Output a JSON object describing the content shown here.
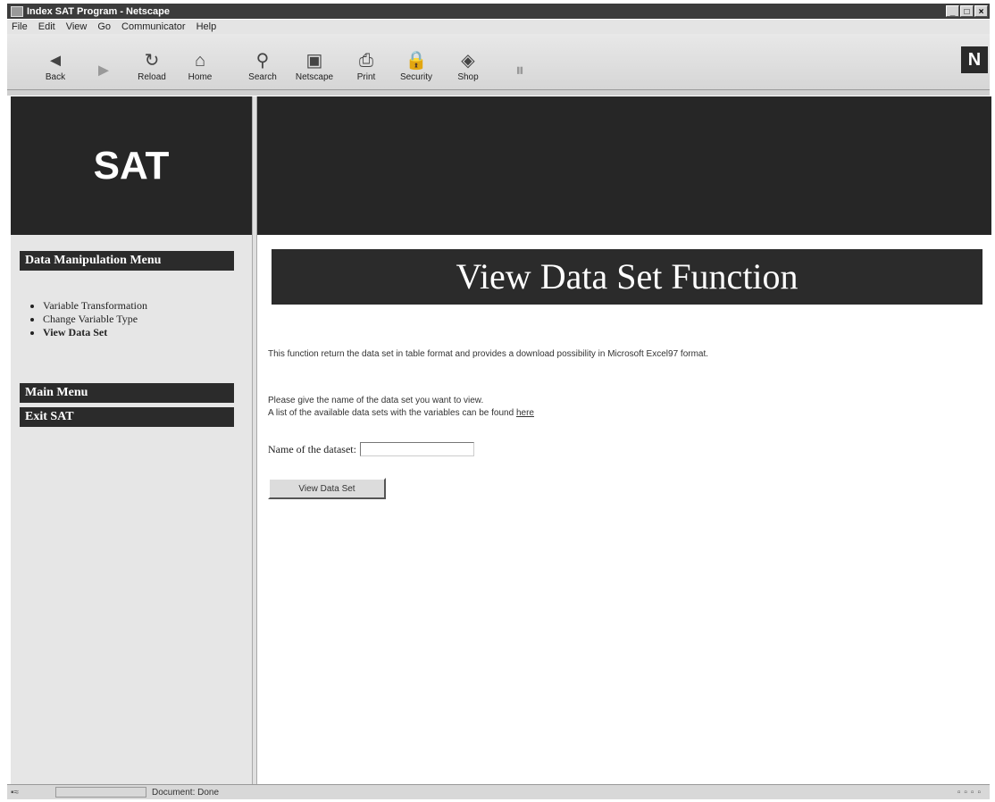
{
  "window": {
    "title": "Index SAT Program - Netscape",
    "controls": [
      "_",
      "□",
      "×"
    ]
  },
  "menubar": [
    "File",
    "Edit",
    "View",
    "Go",
    "Communicator",
    "Help"
  ],
  "toolbar": {
    "buttons": [
      {
        "label": "Back",
        "icon": "back-arrow-icon",
        "glyph": "◄"
      },
      {
        "label": "Forward",
        "icon": "forward-arrow-icon",
        "glyph": "►"
      },
      {
        "label": "Reload",
        "icon": "reload-icon",
        "glyph": "↻"
      },
      {
        "label": "Home",
        "icon": "home-icon",
        "glyph": "⌂"
      },
      {
        "label": "Search",
        "icon": "search-icon",
        "glyph": "⚲"
      },
      {
        "label": "Netscape",
        "icon": "netscape-icon",
        "glyph": "▣"
      },
      {
        "label": "Print",
        "icon": "print-icon",
        "glyph": "⎙"
      },
      {
        "label": "Security",
        "icon": "lock-icon",
        "glyph": "🔒"
      },
      {
        "label": "Shop",
        "icon": "shop-icon",
        "glyph": "◈"
      },
      {
        "label": "",
        "icon": "stop-icon",
        "glyph": "⏸"
      }
    ],
    "logo": "N"
  },
  "page": {
    "sat_title": "SAT",
    "heading": "View Data Set Function",
    "sidebar": {
      "data_menu_title": "Data Manipulation Menu",
      "items": [
        {
          "label": "Variable Transformation"
        },
        {
          "label": "Change Variable Type"
        },
        {
          "label": "View Data Set"
        }
      ],
      "main_menu": "Main Menu",
      "exit": "Exit SAT"
    },
    "description": "This function return the data set in table format and provides a download possibility in Microsoft Excel97 format.",
    "instruction_1": "Please give the name of the data set you want to view.",
    "instruction_2_prefix": "A list of the available data sets with the variables can be found ",
    "instruction_2_link": "here",
    "dataset_label": "Name of the dataset:",
    "dataset_value": "",
    "view_button": "View Data Set"
  },
  "statusbar": {
    "text": "Document: Done"
  }
}
